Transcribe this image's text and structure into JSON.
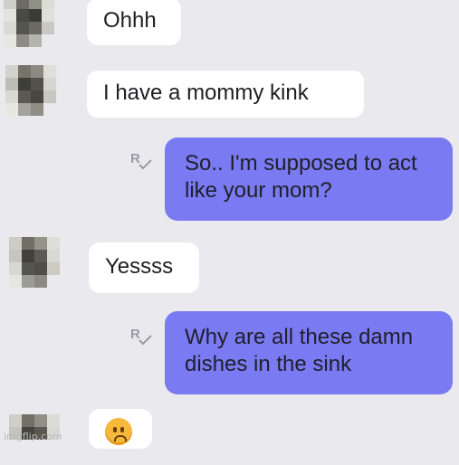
{
  "conversation": {
    "messages": [
      {
        "direction": "incoming",
        "text": "Ohhh"
      },
      {
        "direction": "incoming",
        "text": "I have a mommy kink"
      },
      {
        "direction": "outgoing",
        "text": "So.. I'm supposed to act like your mom?",
        "status_icon": "read-receipt-icon"
      },
      {
        "direction": "incoming",
        "text": "Yessss"
      },
      {
        "direction": "outgoing",
        "text": "Why are all these damn dishes in the sink",
        "status_icon": "read-receipt-icon"
      },
      {
        "direction": "incoming",
        "text": "",
        "emoji_icon": "worried-face-emoji-icon"
      }
    ],
    "read_marker": "R"
  },
  "watermark": "imgflip.com",
  "colors": {
    "background": "#e9e9ee",
    "incoming_bubble": "#ffffff",
    "outgoing_bubble": "#7a7af2"
  }
}
